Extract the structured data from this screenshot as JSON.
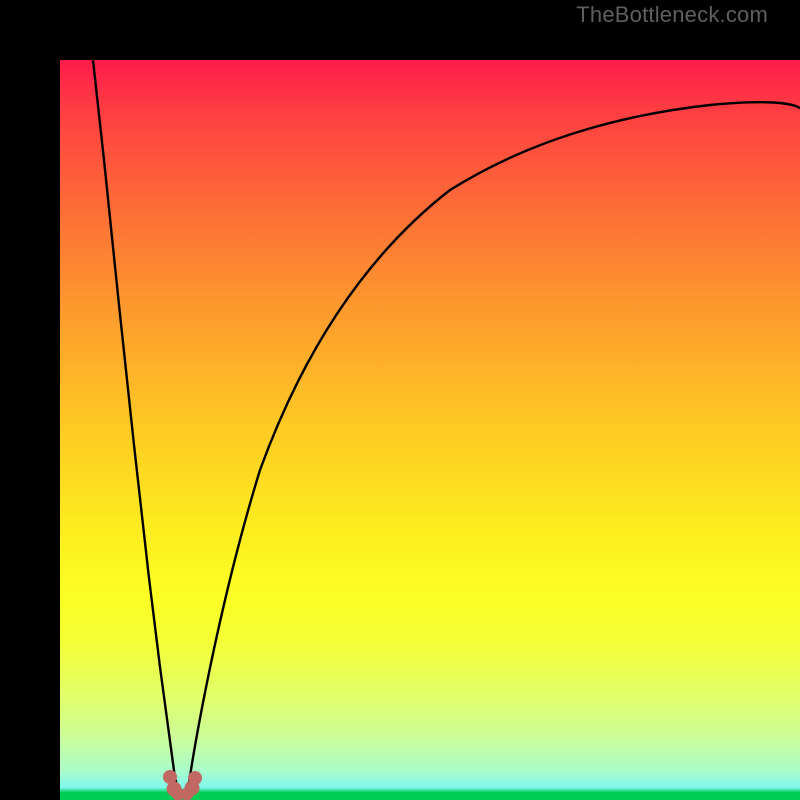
{
  "watermark": "TheBottleneck.com",
  "chart_data": {
    "type": "line",
    "title": "",
    "xlabel": "",
    "ylabel": "",
    "xlim": [
      0,
      100
    ],
    "ylim": [
      0,
      100
    ],
    "grid": false,
    "legend": false,
    "notes": "No axis tick labels or numeric data labels are present in the image; x/y values below are pixel-proportional estimates (0–100 each axis, y=0 at bottom). The two black curves form a sharp V-shape with minimum near x≈15, and a small pink/salmon marker cluster sits in the trough.",
    "series": [
      {
        "name": "left-branch",
        "stroke": "#000000",
        "x": [
          4.5,
          6,
          8,
          10,
          12,
          13.5,
          14.8,
          15.5,
          16.2
        ],
        "y": [
          100,
          86,
          67,
          48,
          30,
          18,
          8,
          3,
          0.5
        ]
      },
      {
        "name": "right-branch",
        "stroke": "#000000",
        "x": [
          17.2,
          18,
          20,
          23,
          27,
          32,
          38,
          45,
          53,
          62,
          72,
          83,
          95,
          100
        ],
        "y": [
          0.5,
          6,
          18,
          32,
          45,
          56,
          65,
          72,
          78,
          83,
          87,
          90,
          92.5,
          93.5
        ]
      },
      {
        "name": "marker-cluster",
        "stroke": "#c06861",
        "type": "scatter",
        "x": [
          14.8,
          15.4,
          16.0,
          17.2,
          17.8,
          18.3
        ],
        "y": [
          3.1,
          1.5,
          0.8,
          0.8,
          1.6,
          3.0
        ]
      }
    ],
    "gradient_stops": [
      {
        "pos": 0.0,
        "color": "#fe1c4b"
      },
      {
        "pos": 0.2,
        "color": "#fd6d37"
      },
      {
        "pos": 0.49,
        "color": "#fec824"
      },
      {
        "pos": 0.72,
        "color": "#fcfe23"
      },
      {
        "pos": 0.91,
        "color": "#ccfd9a"
      },
      {
        "pos": 0.99,
        "color": "#00ce53"
      }
    ]
  }
}
